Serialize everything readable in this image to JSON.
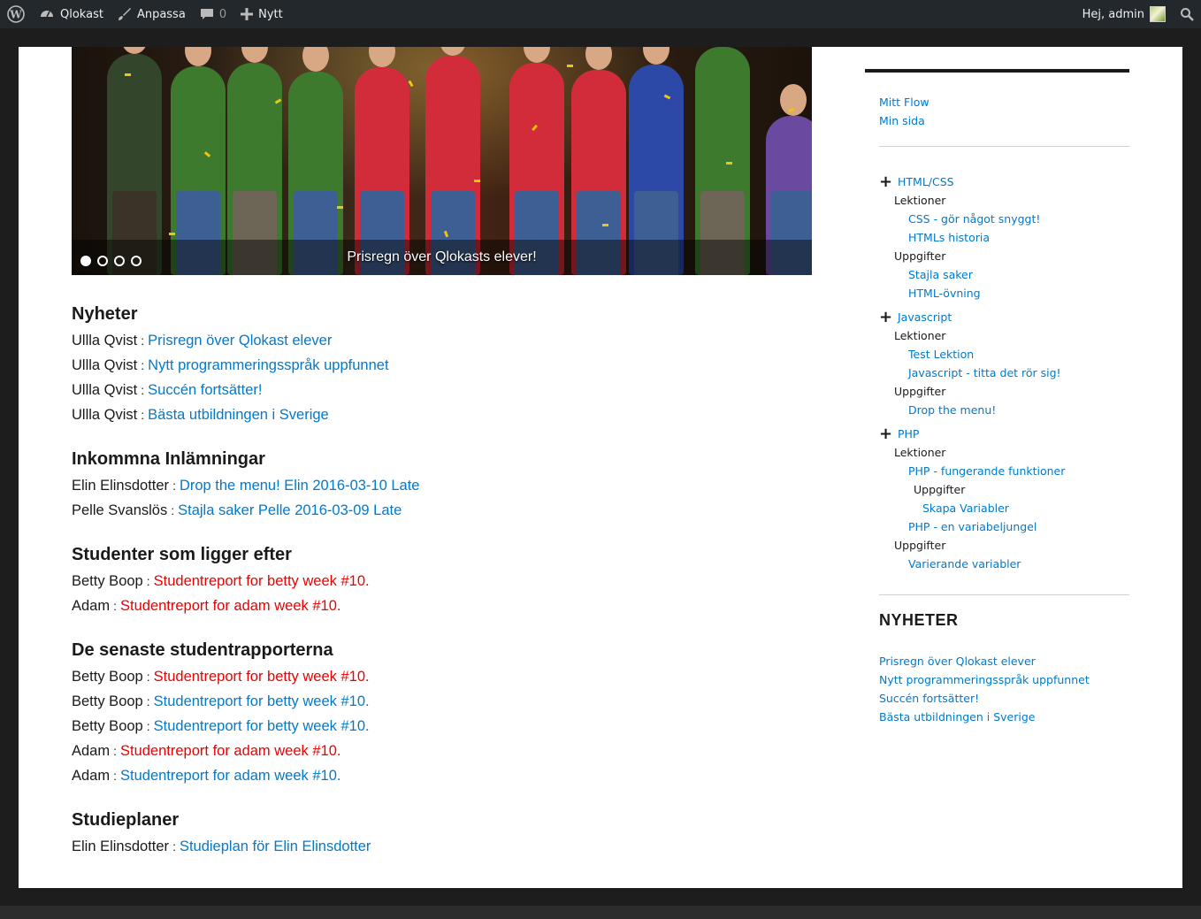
{
  "adminbar": {
    "site_name": "Qlokast",
    "customize": "Anpassa",
    "comments_count": "0",
    "new_label": "Nytt",
    "greeting": "Hej, admin"
  },
  "slider": {
    "caption": "Prisregn över Qlokasts elever!",
    "slide_count": 4,
    "active_slide": 1
  },
  "sections": [
    {
      "title": "Nyheter",
      "items": [
        {
          "name": "Ullla Qvist",
          "link": "Prisregn över Qlokast elever",
          "color": "blue"
        },
        {
          "name": "Ullla Qvist",
          "link": "Nytt programmeringsspråk uppfunnet",
          "color": "blue"
        },
        {
          "name": "Ullla Qvist",
          "link": "Succén fortsätter!",
          "color": "blue"
        },
        {
          "name": "Ullla Qvist",
          "link": "Bästa utbildningen i Sverige",
          "color": "blue"
        }
      ]
    },
    {
      "title": "Inkommna Inlämningar",
      "items": [
        {
          "name": "Elin Elinsdotter",
          "link": "Drop the menu! Elin 2016-03-10 Late",
          "color": "blue"
        },
        {
          "name": "Pelle Svanslös",
          "link": "Stajla saker Pelle 2016-03-09 Late",
          "color": "blue"
        }
      ]
    },
    {
      "title": "Studenter som ligger efter",
      "items": [
        {
          "name": "Betty Boop",
          "link": "Studentreport for betty week #10.",
          "color": "red"
        },
        {
          "name": "Adam",
          "link": "Studentreport for adam week #10.",
          "color": "red"
        }
      ]
    },
    {
      "title": "De senaste studentrapporterna",
      "items": [
        {
          "name": "Betty Boop",
          "link": "Studentreport for betty week #10.",
          "color": "red"
        },
        {
          "name": "Betty Boop",
          "link": "Studentreport for betty week #10.",
          "color": "blue"
        },
        {
          "name": "Betty Boop",
          "link": "Studentreport for betty week #10.",
          "color": "blue"
        },
        {
          "name": "Adam",
          "link": "Studentreport for adam week #10.",
          "color": "red"
        },
        {
          "name": "Adam",
          "link": "Studentreport for adam week #10.",
          "color": "blue"
        }
      ]
    },
    {
      "title": "Studieplaner",
      "items": [
        {
          "name": "Elin Elinsdotter",
          "link": "Studieplan för Elin Elinsdotter",
          "color": "blue"
        }
      ]
    }
  ],
  "sidebar": {
    "links": [
      "Mitt Flow",
      "Min sida"
    ],
    "tree": [
      {
        "topic": "HTML/CSS",
        "entries": [
          {
            "label": "Lektioner",
            "type": "heading",
            "indent": 1
          },
          {
            "label": "CSS - gör något snyggt!",
            "type": "link",
            "indent": 2
          },
          {
            "label": "HTMLs historia",
            "type": "link",
            "indent": 2
          },
          {
            "label": "Uppgifter",
            "type": "heading",
            "indent": 1
          },
          {
            "label": "Stajla saker",
            "type": "link",
            "indent": 2
          },
          {
            "label": "HTML-övning",
            "type": "link",
            "indent": 2
          }
        ]
      },
      {
        "topic": "Javascript",
        "entries": [
          {
            "label": "Lektioner",
            "type": "heading",
            "indent": 1
          },
          {
            "label": "Test Lektion",
            "type": "link",
            "indent": 2
          },
          {
            "label": "Javascript - titta det rör sig!",
            "type": "link",
            "indent": 2
          },
          {
            "label": "Uppgifter",
            "type": "heading",
            "indent": 1
          },
          {
            "label": "Drop the menu!",
            "type": "link",
            "indent": 2
          }
        ]
      },
      {
        "topic": "PHP",
        "entries": [
          {
            "label": "Lektioner",
            "type": "heading",
            "indent": 1
          },
          {
            "label": "PHP - fungerande funktioner",
            "type": "link",
            "indent": 2
          },
          {
            "label": "Uppgifter",
            "type": "heading",
            "indent": 3
          },
          {
            "label": "Skapa Variabler",
            "type": "link",
            "indent": 4
          },
          {
            "label": "PHP - en variabeljungel",
            "type": "link",
            "indent": 2
          },
          {
            "label": "Uppgifter",
            "type": "heading",
            "indent": 1
          },
          {
            "label": "Varierande variabler",
            "type": "link",
            "indent": 2
          }
        ]
      }
    ],
    "news_title": "NYHETER",
    "news": [
      "Prisregn över Qlokast elever",
      "Nytt programmeringsspråk uppfunnet",
      "Succén fortsätter!",
      "Bästa utbildningen i Sverige"
    ]
  },
  "colors": {
    "link_blue": "#007acc",
    "link_red": "#ee0000",
    "adminbar_bg": "#23282d"
  }
}
